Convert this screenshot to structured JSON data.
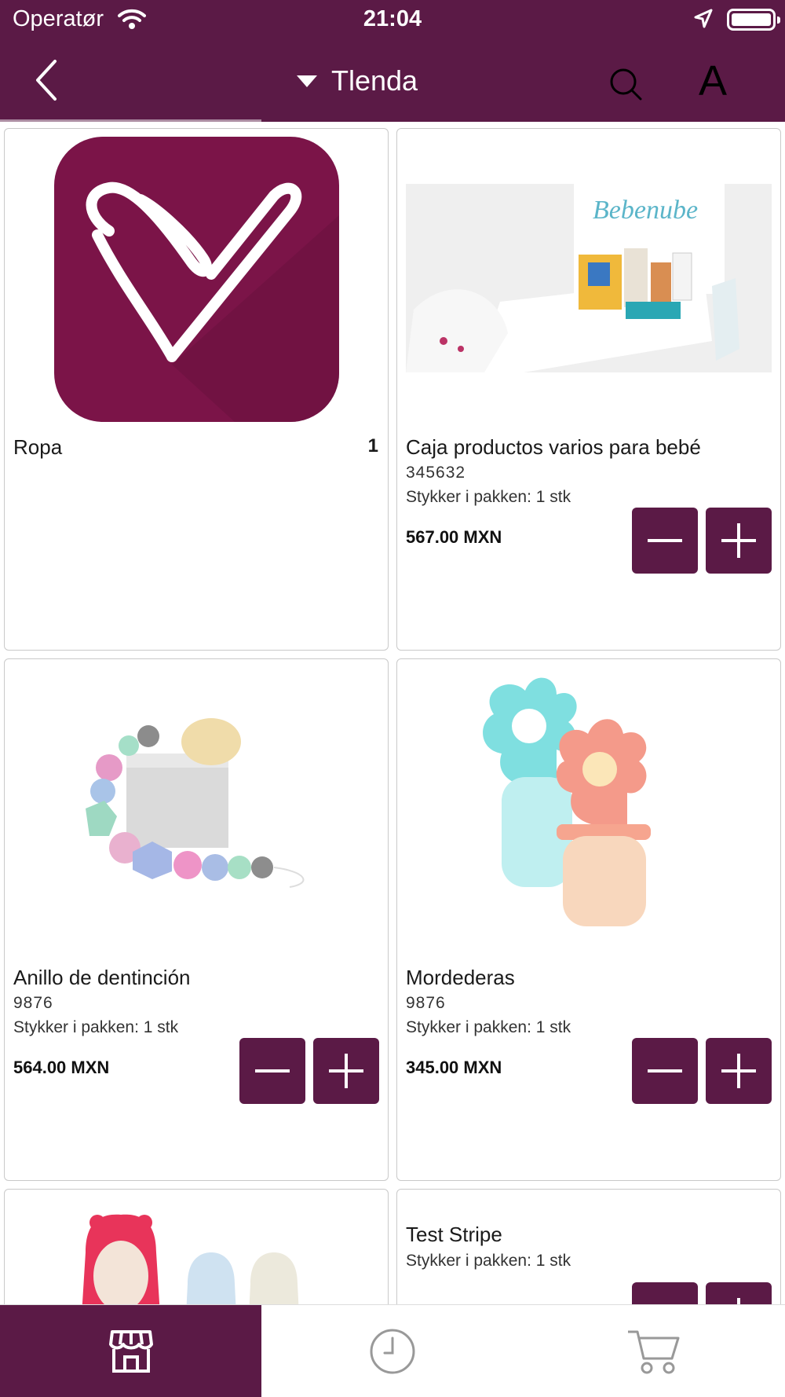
{
  "status_bar": {
    "carrier": "Operatør",
    "time": "21:04"
  },
  "nav": {
    "title": "Tlenda",
    "font_button_label": "A"
  },
  "products": [
    {
      "name": "Ropa",
      "count": "1",
      "sku": "",
      "pack": "",
      "price": ""
    },
    {
      "name": "Caja productos varios para bebé",
      "sku": "345632",
      "pack": "Stykker i pakken: 1 stk",
      "price": "567.00 MXN",
      "image_caption": "Bebenube"
    },
    {
      "name": "Anillo de dentinción",
      "sku": "9876",
      "pack": "Stykker i pakken: 1 stk",
      "price": "564.00 MXN"
    },
    {
      "name": "Mordederas",
      "sku": "9876",
      "pack": "Stykker i pakken: 1 stk",
      "price": "345.00 MXN"
    },
    {
      "name": "",
      "sku": "",
      "pack": "",
      "price": ""
    },
    {
      "name": "Test Stripe",
      "sku": "",
      "pack": "Stykker i pakken: 1 stk",
      "price": ""
    }
  ],
  "tabs": [
    {
      "icon": "store-icon",
      "active": true
    },
    {
      "icon": "clock-icon",
      "active": false
    },
    {
      "icon": "cart-icon",
      "active": false
    }
  ],
  "colors": {
    "brand": "#5b1a46",
    "background": "#ffffff",
    "card_border": "#c9c9c9"
  }
}
